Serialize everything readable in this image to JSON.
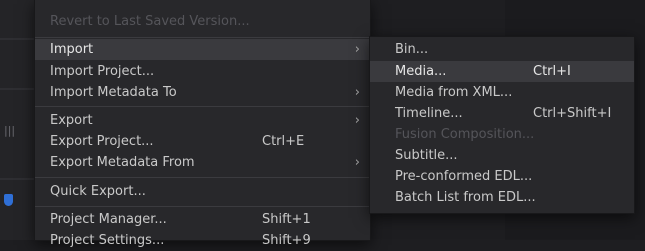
{
  "main_menu": {
    "items": [
      {
        "label": "Revert to Last Saved Version...",
        "shortcut": "",
        "disabled": true
      },
      {
        "label": "Import",
        "shortcut": "",
        "submenu": true,
        "highlighted": true
      },
      {
        "label": "Import Project...",
        "shortcut": ""
      },
      {
        "label": "Import Metadata To",
        "shortcut": "",
        "submenu": true
      },
      {
        "label": "Export",
        "shortcut": "",
        "submenu": true
      },
      {
        "label": "Export Project...",
        "shortcut": "Ctrl+E"
      },
      {
        "label": "Export Metadata From",
        "shortcut": "",
        "submenu": true
      },
      {
        "label": "Quick Export...",
        "shortcut": ""
      },
      {
        "label": "Project Manager...",
        "shortcut": "Shift+1"
      },
      {
        "label": "Project Settings...",
        "shortcut": "Shift+9"
      }
    ]
  },
  "import_submenu": {
    "items": [
      {
        "label": "Bin...",
        "shortcut": ""
      },
      {
        "label": "Media...",
        "shortcut": "Ctrl+I",
        "highlighted": true
      },
      {
        "label": "Media from XML...",
        "shortcut": ""
      },
      {
        "label": "Timeline...",
        "shortcut": "Ctrl+Shift+I"
      },
      {
        "label": "Fusion Composition...",
        "shortcut": "",
        "disabled": true
      },
      {
        "label": "Subtitle...",
        "shortcut": ""
      },
      {
        "label": "Pre-conformed EDL...",
        "shortcut": ""
      },
      {
        "label": "Batch List from EDL...",
        "shortcut": ""
      }
    ]
  },
  "icons": {
    "submenu_arrow": "chevron-right-icon"
  },
  "colors": {
    "menu_bg": "#28282b",
    "highlight_bg": "#3a3a3e",
    "text": "#c9c9c9",
    "disabled_text": "#55555a",
    "accent_blue": "#2f6fd6"
  }
}
